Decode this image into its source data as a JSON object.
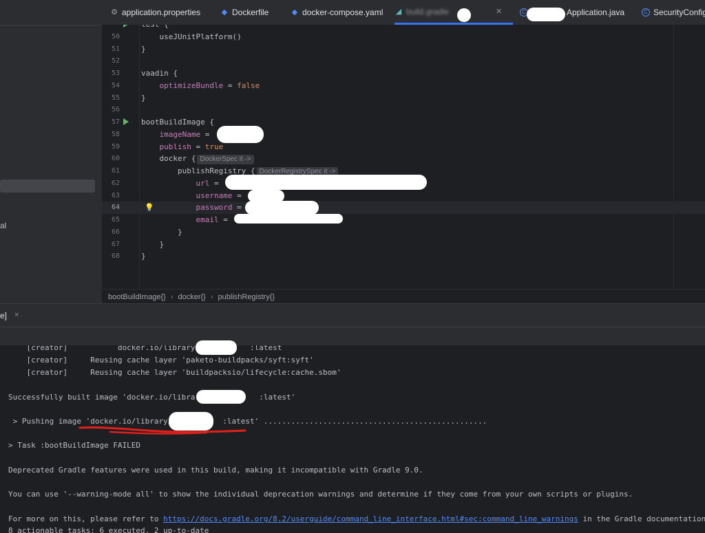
{
  "tabs": [
    {
      "label": "application.properties",
      "icon": "gear-icon"
    },
    {
      "label": "Dockerfile",
      "icon": "docker-icon"
    },
    {
      "label": "docker-compose.yaml",
      "icon": "docker-icon"
    },
    {
      "label": "build.gradle",
      "icon": "gradle-icon",
      "active": true
    },
    {
      "label": "Application.java",
      "icon": "class-icon"
    },
    {
      "label": "SecurityConfig",
      "icon": "class-icon"
    }
  ],
  "sidebar": {
    "fragment": "al"
  },
  "editor": {
    "lines": [
      {
        "n": "",
        "text": "test {"
      },
      {
        "n": "50",
        "text": "    useJUnitPlatform()"
      },
      {
        "n": "51",
        "text": "}"
      },
      {
        "n": "52",
        "text": ""
      },
      {
        "n": "53",
        "text": "vaadin {"
      },
      {
        "n": "54",
        "prop": "    optimizeBundle",
        "rest": " = ",
        "kw": "false"
      },
      {
        "n": "55",
        "text": "}"
      },
      {
        "n": "56",
        "text": ""
      },
      {
        "n": "57",
        "text": "bootBuildImage {"
      },
      {
        "n": "58",
        "prop": "    imageName",
        "rest": " = "
      },
      {
        "n": "59",
        "prop": "    publish",
        "rest": " = ",
        "kw": "true"
      },
      {
        "n": "60",
        "text": "    docker {",
        "hint": "DockerSpec it ->"
      },
      {
        "n": "61",
        "text": "        publishRegistry {",
        "hint": "DockerRegistrySpec it ->"
      },
      {
        "n": "62",
        "prop": "            url",
        "rest": " = "
      },
      {
        "n": "63",
        "prop": "            username",
        "rest": " = "
      },
      {
        "n": "64",
        "prop": "            password",
        "rest": " = "
      },
      {
        "n": "65",
        "prop": "            email",
        "rest": " = "
      },
      {
        "n": "66",
        "text": "        }"
      },
      {
        "n": "67",
        "text": "    }"
      },
      {
        "n": "68",
        "text": "}"
      }
    ]
  },
  "breadcrumb": [
    "bootBuildImage{}",
    "docker{}",
    "publishRegistry{}"
  ],
  "tool_window": {
    "tab_label": "e]",
    "close": "×"
  },
  "console": {
    "lines": [
      "    [creator]           docker.io/library/           :latest",
      "    [creator]     Reusing cache layer 'paketo-buildpacks/syft:syft'",
      "    [creator]     Reusing cache layer 'buildpacksio/lifecycle:cache.sbom'",
      "",
      "Successfully built image 'docker.io/library/           :latest'",
      "",
      " > Pushing image 'docker.io/library/           :latest' .................................................",
      "",
      "> Task :bootBuildImage FAILED",
      "",
      "Deprecated Gradle features were used in this build, making it incompatible with Gradle 9.0.",
      "",
      "You can use '--warning-mode all' to show the individual deprecation warnings and determine if they come from your own scripts or plugins.",
      "",
      "",
      "8 actionable tasks: 6 executed, 2 up-to-date"
    ],
    "more_info_prefix": "For more on this, please refer to ",
    "more_info_link": "https://docs.gradle.org/8.2/userguide/command_line_interface.html#sec:command_line_warnings",
    "more_info_suffix": " in the Gradle documentation."
  },
  "colors": {
    "accent": "#3574f0",
    "annotation": "#e0201c",
    "redaction": "#ffffff"
  }
}
